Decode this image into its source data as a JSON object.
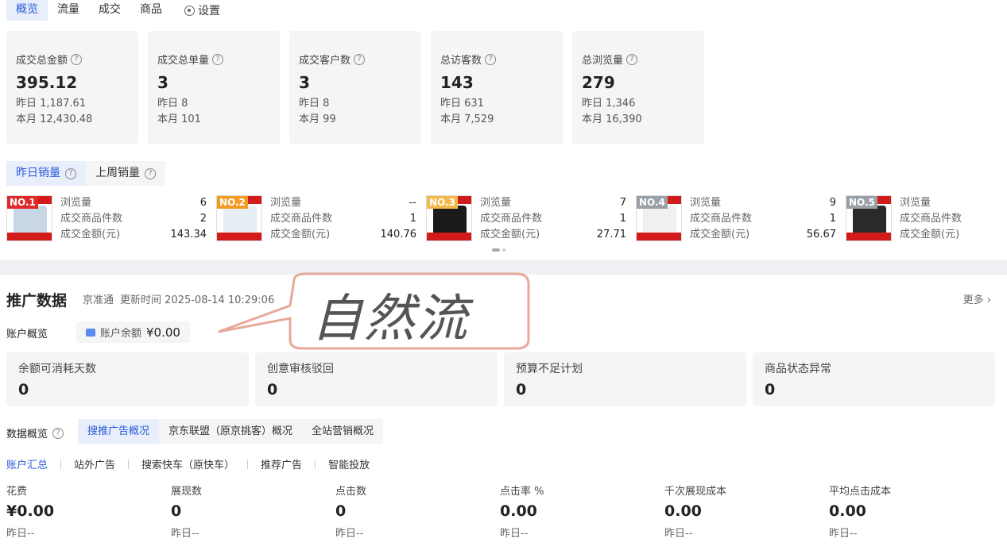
{
  "tabs": [
    {
      "label": "概览"
    },
    {
      "label": "流量"
    },
    {
      "label": "成交"
    },
    {
      "label": "商品"
    }
  ],
  "settings_label": "设置",
  "stats": [
    {
      "label": "成交总金额",
      "value": "395.12",
      "yesterday": "昨日 1,187.61",
      "month": "本月 12,430.48"
    },
    {
      "label": "成交总单量",
      "value": "3",
      "yesterday": "昨日 8",
      "month": "本月 101"
    },
    {
      "label": "成交客户数",
      "value": "3",
      "yesterday": "昨日 8",
      "month": "本月 99"
    },
    {
      "label": "总访客数",
      "value": "143",
      "yesterday": "昨日 631",
      "month": "本月 7,529"
    },
    {
      "label": "总浏览量",
      "value": "279",
      "yesterday": "昨日 1,346",
      "month": "本月 16,390"
    }
  ],
  "sales_tabs": [
    {
      "label": "昨日销量"
    },
    {
      "label": "上周销量"
    }
  ],
  "products": [
    {
      "rank": "NO.1",
      "rank_color": "#e02a2a",
      "views_label": "浏览量",
      "views": "6",
      "items_label": "成交商品件数",
      "items": "2",
      "amount_label": "成交金额(元)",
      "amount": "143.34",
      "img_color": "#c9d6e6"
    },
    {
      "rank": "NO.2",
      "rank_color": "#f29b22",
      "views_label": "浏览量",
      "views": "--",
      "items_label": "成交商品件数",
      "items": "1",
      "amount_label": "成交金额(元)",
      "amount": "140.76",
      "img_color": "#e7eef5"
    },
    {
      "rank": "NO.3",
      "rank_color": "#f3b94a",
      "views_label": "浏览量",
      "views": "7",
      "items_label": "成交商品件数",
      "items": "1",
      "amount_label": "成交金额(元)",
      "amount": "27.71",
      "img_color": "#1a1a1a"
    },
    {
      "rank": "NO.4",
      "rank_color": "#9aa0a8",
      "views_label": "浏览量",
      "views": "9",
      "items_label": "成交商品件数",
      "items": "1",
      "amount_label": "成交金额(元)",
      "amount": "56.67",
      "img_color": "#f0f0f0"
    },
    {
      "rank": "NO.5",
      "rank_color": "#9aa0a8",
      "views_label": "浏览量",
      "views": "",
      "items_label": "成交商品件数",
      "items": "",
      "amount_label": "成交金额(元)",
      "amount": "",
      "img_color": "#2a2a2a"
    }
  ],
  "promo": {
    "title": "推广数据",
    "platform": "京准通",
    "update_time": "更新时间 2025-08-14 10:29:06",
    "more": "更多 ›"
  },
  "account": {
    "label": "账户概览",
    "balance_label": "账户余额",
    "balance_value": "¥0.00"
  },
  "warnings": [
    {
      "label": "余额可消耗天数",
      "value": "0"
    },
    {
      "label": "创意审核驳回",
      "value": "0"
    },
    {
      "label": "预算不足计划",
      "value": "0"
    },
    {
      "label": "商品状态异常",
      "value": "0"
    }
  ],
  "overview": {
    "label": "数据概览",
    "tabs": [
      {
        "label": "搜推广告概况"
      },
      {
        "label": "京东联盟（原京挑客）概况"
      },
      {
        "label": "全站营销概况"
      }
    ]
  },
  "sub_tabs": [
    {
      "label": "账户汇总"
    },
    {
      "label": "站外广告"
    },
    {
      "label": "搜索快车（原快车）"
    },
    {
      "label": "推荐广告"
    },
    {
      "label": "智能投放"
    }
  ],
  "metrics": [
    {
      "label": "花费",
      "value": "¥0.00",
      "sub": "昨日--"
    },
    {
      "label": "展现数",
      "value": "0",
      "sub": "昨日--"
    },
    {
      "label": "点击数",
      "value": "0",
      "sub": "昨日--"
    },
    {
      "label": "点击率 %",
      "value": "0.00",
      "sub": "昨日--"
    },
    {
      "label": "千次展现成本",
      "value": "0.00",
      "sub": "昨日--"
    },
    {
      "label": "平均点击成本",
      "value": "0.00",
      "sub": "昨日--"
    }
  ],
  "annotation_text": "自然流",
  "colors": {
    "accent": "#2a5bd7",
    "annotation_stroke": "#e8a89a"
  }
}
